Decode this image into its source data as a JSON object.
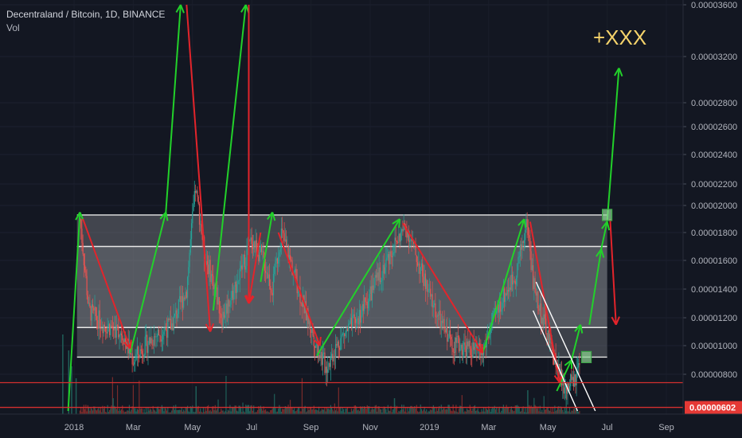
{
  "header": {
    "symbol_title": "Decentraland / Bitcoin, 1D, BINANCE",
    "volume_label": "Vol"
  },
  "chart_data": {
    "type": "candlestick",
    "title": "Decentraland / Bitcoin, 1D, BINANCE",
    "annotation": "+XXX",
    "current_price": "0.00000602",
    "y_ticks": [
      {
        "label": "0.00003600",
        "value": 3600
      },
      {
        "label": "0.00003200",
        "value": 3200
      },
      {
        "label": "0.00002800",
        "value": 2800
      },
      {
        "label": "0.00002600",
        "value": 2600
      },
      {
        "label": "0.00002400",
        "value": 2400
      },
      {
        "label": "0.00002200",
        "value": 2200
      },
      {
        "label": "0.00002000",
        "value": 2000
      },
      {
        "label": "0.00001800",
        "value": 1800
      },
      {
        "label": "0.00001600",
        "value": 1600
      },
      {
        "label": "0.00001400",
        "value": 1400
      },
      {
        "label": "0.00001200",
        "value": 1200
      },
      {
        "label": "0.00001000",
        "value": 1000
      },
      {
        "label": "0.00000800",
        "value": 800
      }
    ],
    "x_ticks": [
      {
        "label": "2018",
        "month": 0
      },
      {
        "label": "Mar",
        "month": 2
      },
      {
        "label": "May",
        "month": 4
      },
      {
        "label": "Jul",
        "month": 6
      },
      {
        "label": "Sep",
        "month": 8
      },
      {
        "label": "Nov",
        "month": 10
      },
      {
        "label": "2019",
        "month": 12
      },
      {
        "label": "Mar",
        "month": 14
      },
      {
        "label": "May",
        "month": 16
      },
      {
        "label": "Jul",
        "month": 18
      },
      {
        "label": "Sep",
        "month": 20
      }
    ],
    "price_path": [
      [
        0.2,
        1900
      ],
      [
        0.5,
        1250
      ],
      [
        1.0,
        1150
      ],
      [
        1.6,
        1100
      ],
      [
        2.0,
        900
      ],
      [
        2.6,
        1050
      ],
      [
        3.3,
        1150
      ],
      [
        3.8,
        1400
      ],
      [
        4.1,
        2150
      ],
      [
        4.4,
        1650
      ],
      [
        4.7,
        1450
      ],
      [
        5.0,
        1200
      ],
      [
        5.6,
        1500
      ],
      [
        6.0,
        1750
      ],
      [
        6.4,
        1600
      ],
      [
        6.7,
        1400
      ],
      [
        7.0,
        1800
      ],
      [
        7.3,
        1600
      ],
      [
        7.8,
        1250
      ],
      [
        8.2,
        1000
      ],
      [
        8.5,
        850
      ],
      [
        9.0,
        1050
      ],
      [
        9.6,
        1200
      ],
      [
        10.2,
        1450
      ],
      [
        10.8,
        1700
      ],
      [
        11.2,
        1850
      ],
      [
        11.6,
        1600
      ],
      [
        12.0,
        1350
      ],
      [
        12.4,
        1150
      ],
      [
        12.8,
        1020
      ],
      [
        13.3,
        980
      ],
      [
        13.8,
        950
      ],
      [
        14.1,
        1150
      ],
      [
        14.5,
        1350
      ],
      [
        14.9,
        1500
      ],
      [
        15.3,
        1880
      ],
      [
        15.5,
        1450
      ],
      [
        15.8,
        1200
      ],
      [
        16.1,
        1000
      ],
      [
        16.4,
        800
      ],
      [
        16.6,
        700
      ],
      [
        16.9,
        760
      ],
      [
        17.1,
        860
      ]
    ],
    "channel": {
      "lines": [
        1930,
        1700,
        1130,
        920
      ],
      "x_start": 0.1,
      "x_end": 18.0
    },
    "arrows": {
      "green": [
        [
          [
            -0.2,
            580
          ],
          [
            0.2,
            1950
          ]
        ],
        [
          [
            0.8,
            1050
          ],
          [
            0.8,
            1050
          ]
        ],
        [
          [
            1.9,
            950
          ],
          [
            3.1,
            1950
          ]
        ],
        [
          [
            3.1,
            1950
          ],
          [
            3.6,
            3600
          ]
        ],
        [
          [
            4.7,
            1250
          ],
          [
            5.8,
            3600
          ]
        ],
        [
          [
            6.3,
            1450
          ],
          [
            6.7,
            1950
          ]
        ],
        [
          [
            8.2,
            930
          ],
          [
            11.0,
            1900
          ]
        ],
        [
          [
            13.8,
            950
          ],
          [
            15.2,
            1900
          ]
        ],
        [
          [
            16.3,
            700
          ],
          [
            16.8,
            900
          ]
        ],
        [
          [
            16.8,
            900
          ],
          [
            17.1,
            1150
          ]
        ],
        [
          [
            17.4,
            1150
          ],
          [
            17.8,
            1680
          ]
        ],
        [
          [
            17.8,
            1680
          ],
          [
            18.0,
            1880
          ]
        ],
        [
          [
            18.0,
            1880
          ],
          [
            18.4,
            3100
          ]
        ]
      ],
      "red": [
        [
          [
            0.3,
            1900
          ],
          [
            1.9,
            980
          ]
        ],
        [
          [
            3.8,
            3600
          ],
          [
            4.6,
            1100
          ]
        ],
        [
          [
            5.9,
            3600
          ],
          [
            5.9,
            1300
          ]
        ],
        [
          [
            6.3,
            1800
          ],
          [
            5.9,
            1300
          ]
        ],
        [
          [
            6.9,
            1800
          ],
          [
            8.3,
            1000
          ]
        ],
        [
          [
            11.1,
            1870
          ],
          [
            13.8,
            950
          ]
        ],
        [
          [
            15.4,
            1880
          ],
          [
            16.4,
            750
          ]
        ],
        [
          [
            18.1,
            1900
          ],
          [
            18.3,
            1150
          ]
        ]
      ]
    },
    "wedge": {
      "upper": [
        [
          15.6,
          1450
        ],
        [
          17.6,
          580
        ]
      ],
      "lower": [
        [
          15.5,
          1250
        ],
        [
          17.0,
          580
        ]
      ]
    },
    "boxes": [
      [
        18.0,
        1930
      ],
      [
        17.3,
        920
      ]
    ],
    "red_levels": [
      750,
      602
    ]
  }
}
